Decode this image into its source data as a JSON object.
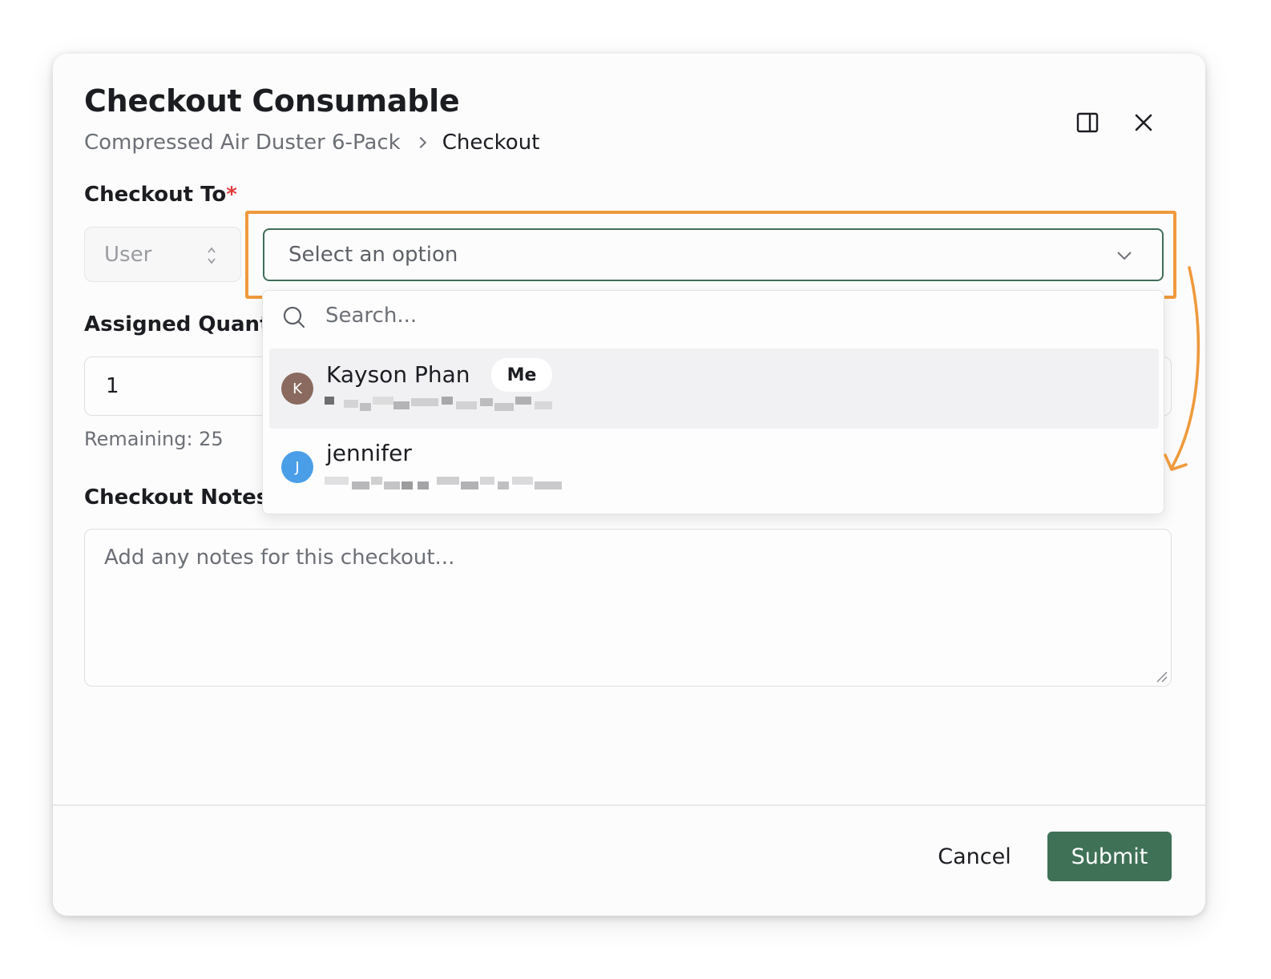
{
  "dialog": {
    "title": "Checkout Consumable",
    "breadcrumb": {
      "parent": "Compressed Air Duster 6-Pack",
      "current": "Checkout"
    }
  },
  "form": {
    "checkout_to": {
      "label": "Checkout To",
      "required_mark": "*",
      "type_select": {
        "value": "User"
      },
      "option_select": {
        "placeholder": "Select an option"
      }
    },
    "assigned_quantity": {
      "label": "Assigned Quantity",
      "value": "1",
      "remaining": "Remaining: 25"
    },
    "notes": {
      "label": "Checkout Notes",
      "placeholder": "Add any notes for this checkout..."
    }
  },
  "dropdown": {
    "search_placeholder": "Search...",
    "users": [
      {
        "initial": "K",
        "name": "Kayson Phan",
        "badge": "Me",
        "avatar_color": "#8a6a5e",
        "highlighted": true
      },
      {
        "initial": "J",
        "name": "jennifer",
        "badge": "",
        "avatar_color": "#4a9ee8",
        "highlighted": false
      }
    ]
  },
  "footer": {
    "cancel_label": "Cancel",
    "submit_label": "Submit"
  },
  "colors": {
    "accent": "#3f7157",
    "highlight": "#ef9a3c",
    "required": "#e03b3b"
  },
  "icons": [
    "panel-toggle-icon",
    "close-icon",
    "updown-chevron-icon",
    "chevron-down-icon",
    "search-icon",
    "resize-handle-icon",
    "annotation-arrow"
  ]
}
